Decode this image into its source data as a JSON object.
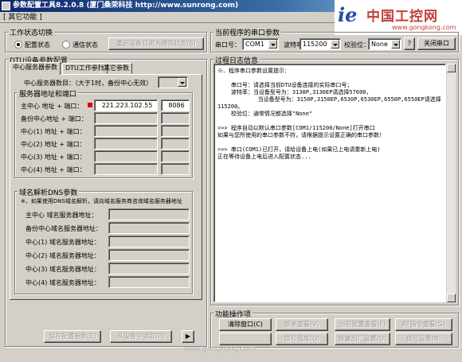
{
  "window": {
    "title": "参数配置工具8.2.0.8 (厦门桑荣科技 http://www.sunrong.com)"
  },
  "menu": {
    "items": [
      "[ 其它功能 ]"
    ]
  },
  "logo": {
    "mark": "ie",
    "text": "中国工控网",
    "url": "www.gongkong.com"
  },
  "work_state": {
    "group_label": "工作状态切换",
    "config_label": "配置状态",
    "comm_label": "通信状态",
    "config_selected": true,
    "restart_btn": "重启设备且进入通信状态(S)"
  },
  "serial": {
    "group_label": "当前程序的串口参数",
    "port_label": "串口号：",
    "port_value": "COM1",
    "baud_label": "波特率：",
    "baud_value": "115200",
    "parity_label": "校验位：",
    "parity_value": "None",
    "help_btn": "?",
    "close_btn": "关闭串口"
  },
  "dtu": {
    "group_label": "DTU设备参数配置",
    "tabs": [
      "中心服务器参数",
      "DTU工作参数",
      "其它参数"
    ],
    "server_count_label": "中心服务器数目：（大于1时，备份中心无效）",
    "addr_group_label": "服务器地址和端口",
    "rows": [
      {
        "label": "主中心   地址 + 端口：",
        "addr": "221.223.102.55",
        "port": "8086",
        "active": true
      },
      {
        "label": "备份中心地址 + 端口：",
        "addr": "",
        "port": "",
        "active": false
      },
      {
        "label": "中心(1)  地址 + 端口：",
        "addr": "",
        "port": "",
        "active": false
      },
      {
        "label": "中心(2)  地址 + 端口：",
        "addr": "",
        "port": "",
        "active": false
      },
      {
        "label": "中心(3)  地址 + 端口：",
        "addr": "",
        "port": "",
        "active": false
      },
      {
        "label": "中心(4)  地址 + 端口：",
        "addr": "",
        "port": "",
        "active": false
      }
    ],
    "dns_group_label": "域名解析DNS参数",
    "dns_note": "※、如果使用DNS域名解析，请向域名服务商咨询域名服务器地址",
    "dns_rows": [
      "主中心   域名服务器地址：",
      "备份中心域名服务器地址：",
      "中心(1)  域名服务器地址：",
      "中心(2)  域名服务器地址：",
      "中心(3)  域名服务器地址：",
      "中心(4)  域名服务器地址："
    ],
    "save_btn": "保存配置参数(E)",
    "read_btn": "从设备中读取(R)",
    "play_btn": "▶"
  },
  "log": {
    "group_label": "过程日志信息",
    "text": "※、程序串口参数设置提示：\n\n    串口号：请选择当前DTU设备连接的实际串口号；\n    波特率：当设备型号为：3130P,3130EP请选择57600，\n            当设备型号为：3150P,3150EP,6530P,6530EP,6550P,6550EP请选择\n115200。\n    校验位：通常情况都选择\"None\"\n\n>>> 程序自动以默认串口参数[COM1/115200/None]打开串口\n如果与您所使用的串口参数不符，请根据提示设置正确的串口参数！\n\n>>> 串口(COM1)已打开，请给设备上电(如果已上电请重新上电)\n正在等待设备上电后进入配置状态..."
  },
  "ops": {
    "group_label": "功能操作项",
    "row1": [
      "清除窗口(C)",
      "版本查看(V)",
      "当前配置查看(F)",
      "AT指令查看(G)"
    ],
    "row2": [
      "",
      "信号强度(Q)",
      "恢复出厂设置(D)",
      "拨号设置(N)"
    ]
  },
  "watermark": "www.gongkong.com"
}
